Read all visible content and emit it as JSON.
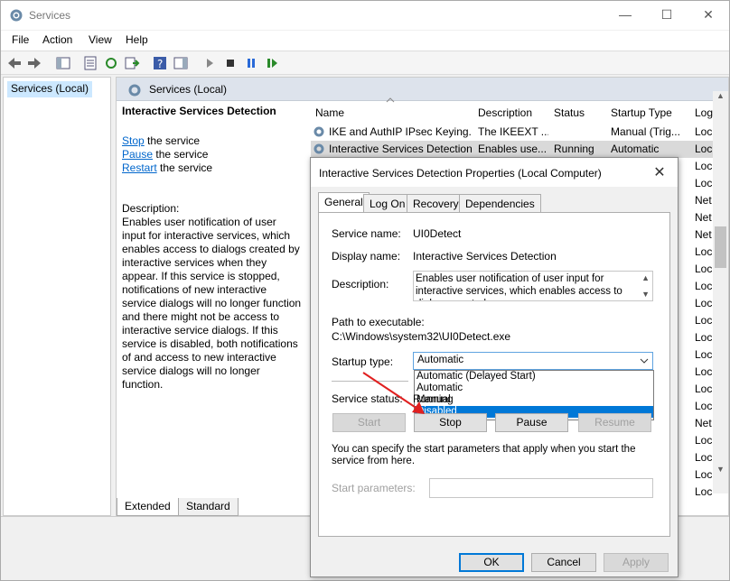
{
  "window": {
    "title": "Services",
    "min": "—",
    "max": "☐",
    "close": "✕"
  },
  "menu": [
    "File",
    "Action",
    "View",
    "Help"
  ],
  "tree": {
    "root": "Services (Local)"
  },
  "panel": {
    "header": "Services (Local)",
    "selected_title": "Interactive Services Detection",
    "actions": [
      {
        "link": "Stop",
        "rest": " the service"
      },
      {
        "link": "Pause",
        "rest": " the service"
      },
      {
        "link": "Restart",
        "rest": " the service"
      }
    ],
    "description_label": "Description:",
    "description": "Enables user notification of user input for interactive services, which enables access to dialogs created by interactive services when they appear. If this service is stopped, notifications of new interactive service dialogs will no longer function and there might not be access to interactive service dialogs. If this service is disabled, both notifications of and access to new interactive service dialogs will no longer function.",
    "columns": {
      "name": "Name",
      "description": "Description",
      "status": "Status",
      "startup": "Startup Type",
      "log": "Log"
    },
    "rows": [
      {
        "name": "IKE and AuthIP IPsec Keying...",
        "desc": "The IKEEXT ...",
        "status": "",
        "startup": "Manual (Trig...",
        "log": "Loc"
      },
      {
        "name": "Interactive Services Detection",
        "desc": "Enables use...",
        "status": "Running",
        "startup": "Automatic",
        "log": "Loc"
      }
    ],
    "log_column": [
      "Loc",
      "Loc",
      "Net",
      "Net",
      "Net",
      "Loc",
      "Loc",
      "Loc",
      "Loc",
      "Loc",
      "Loc",
      "Loc",
      "Loc",
      "Loc",
      "Loc",
      "Net",
      "Loc",
      "Loc",
      "Loc",
      "Loc"
    ],
    "tabs": [
      "Extended",
      "Standard"
    ]
  },
  "dialog": {
    "title": "Interactive Services Detection Properties (Local Computer)",
    "close": "✕",
    "tabs": [
      "General",
      "Log On",
      "Recovery",
      "Dependencies"
    ],
    "service_name_label": "Service name:",
    "service_name": "UI0Detect",
    "display_name_label": "Display name:",
    "display_name": "Interactive Services Detection",
    "description_label": "Description:",
    "description": "Enables user notification of user input for interactive services, which enables access to dialogs created",
    "path_label": "Path to executable:",
    "path": "C:\\Windows\\system32\\UI0Detect.exe",
    "startup_type_label": "Startup type:",
    "startup_type_value": "Automatic",
    "startup_options": [
      "Automatic (Delayed Start)",
      "Automatic",
      "Manual",
      "Disabled"
    ],
    "startup_highlighted": "Disabled",
    "service_status_label": "Service status:",
    "service_status": "Running",
    "buttons": {
      "start": "Start",
      "stop": "Stop",
      "pause": "Pause",
      "resume": "Resume"
    },
    "hint": "You can specify the start parameters that apply when you start the service from here.",
    "start_params_label": "Start parameters:",
    "start_params_value": "",
    "footer": {
      "ok": "OK",
      "cancel": "Cancel",
      "apply": "Apply"
    }
  },
  "colors": {
    "selection": "#0078d7",
    "header": "#dde3ec",
    "arrow": "#e02020",
    "tree_selected": "#cce8ff"
  }
}
